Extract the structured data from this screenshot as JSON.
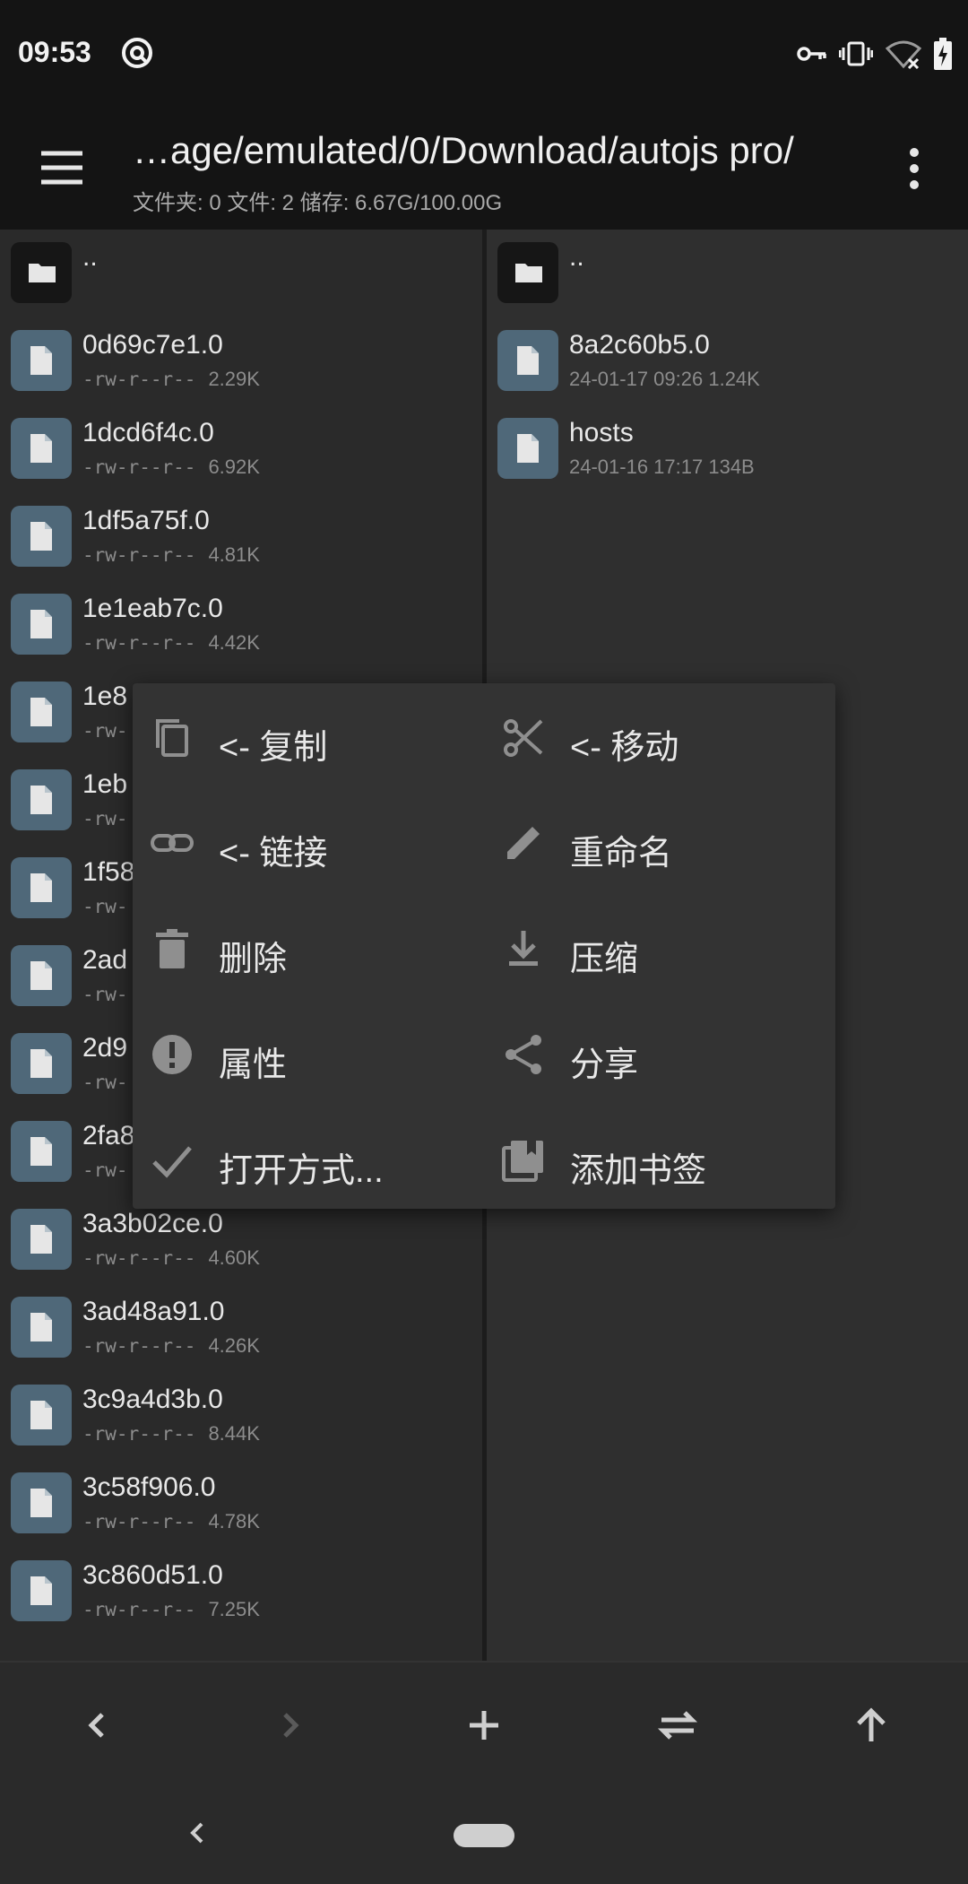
{
  "status_bar": {
    "time": "09:53",
    "icons": [
      "hotspot-icon",
      "vpn-key-icon",
      "vibrate-icon",
      "wifi-off-icon",
      "battery-charging-icon"
    ]
  },
  "toolbar": {
    "path": "…age/emulated/0/Download/autojs pro/",
    "stats": "文件夹: 0  文件: 2  储存: 6.67G/100.00G",
    "menu_icon": "hamburger-menu-icon",
    "more_icon": "more-vert-icon"
  },
  "left_pane": {
    "parent": "..",
    "files": [
      {
        "name": "0d69c7e1.0",
        "perm": "-rw-r--r--",
        "size": "2.29K"
      },
      {
        "name": "1dcd6f4c.0",
        "perm": "-rw-r--r--",
        "size": "6.92K"
      },
      {
        "name": "1df5a75f.0",
        "perm": "-rw-r--r--",
        "size": "4.81K"
      },
      {
        "name": "1e1eab7c.0",
        "perm": "-rw-r--r--",
        "size": "4.42K"
      },
      {
        "name": "1e8",
        "perm": "-rw-",
        "size": ""
      },
      {
        "name": "1eb",
        "perm": "-rw-",
        "size": ""
      },
      {
        "name": "1f58",
        "perm": "-rw-",
        "size": ""
      },
      {
        "name": "2ad",
        "perm": "-rw-",
        "size": ""
      },
      {
        "name": "2d9",
        "perm": "-rw-",
        "size": ""
      },
      {
        "name": "2fa8",
        "perm": "-rw-",
        "size": ""
      },
      {
        "name": "3a3b02ce.0",
        "perm": "-rw-r--r--",
        "size": "4.60K"
      },
      {
        "name": "3ad48a91.0",
        "perm": "-rw-r--r--",
        "size": "4.26K"
      },
      {
        "name": "3c9a4d3b.0",
        "perm": "-rw-r--r--",
        "size": "8.44K"
      },
      {
        "name": "3c58f906.0",
        "perm": "-rw-r--r--",
        "size": "4.78K"
      },
      {
        "name": "3c860d51.0",
        "perm": "-rw-r--r--",
        "size": "7.25K"
      }
    ]
  },
  "right_pane": {
    "parent": "..",
    "files": [
      {
        "name": "8a2c60b5.0",
        "date": "24-01-17 09:26",
        "size": "1.24K"
      },
      {
        "name": "hosts",
        "date": "24-01-16 17:17",
        "size": "134B"
      }
    ]
  },
  "context_menu": {
    "items": [
      {
        "label": "<- 复制",
        "icon": "copy-icon"
      },
      {
        "label": "<- 移动",
        "icon": "cut-icon"
      },
      {
        "label": "<- 链接",
        "icon": "link-icon"
      },
      {
        "label": "重命名",
        "icon": "edit-pencil-icon"
      },
      {
        "label": "删除",
        "icon": "delete-icon"
      },
      {
        "label": "压缩",
        "icon": "compress-download-icon"
      },
      {
        "label": "属性",
        "icon": "info-icon"
      },
      {
        "label": "分享",
        "icon": "share-icon"
      },
      {
        "label": "打开方式...",
        "icon": "check-icon"
      },
      {
        "label": "添加书签",
        "icon": "bookmark-icon"
      }
    ]
  },
  "bottom_bar": {
    "buttons": [
      "back-arrow-icon",
      "forward-arrow-icon",
      "add-icon",
      "swap-icon",
      "up-arrow-icon"
    ]
  },
  "colors": {
    "background": "#2a2a2a",
    "file_icon": "#4f6879",
    "folder_icon": "#161616",
    "menu_bg": "#333333"
  }
}
